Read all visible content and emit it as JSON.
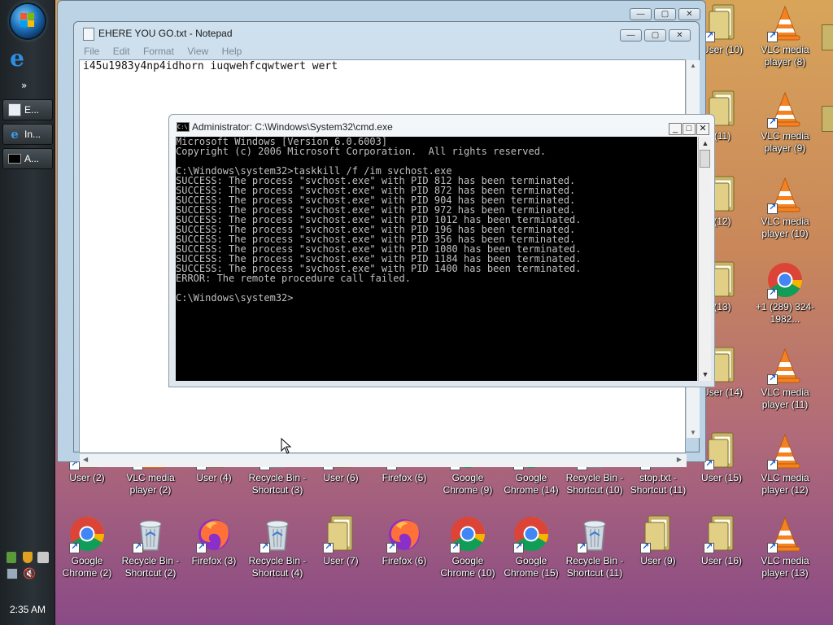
{
  "taskbar": {
    "start_orb": "start-orb-icon",
    "quick_launch_chevron": "»",
    "buttons": [
      {
        "label": "E...",
        "icon": "notepad-icon"
      },
      {
        "label": "In...",
        "icon": "ie-icon"
      },
      {
        "label": "A...",
        "icon": "cmd-icon"
      }
    ],
    "clock": "2:35 AM"
  },
  "notepad": {
    "title": "EHERE YOU GO.txt - Notepad",
    "menu": [
      "File",
      "Edit",
      "Format",
      "View",
      "Help"
    ],
    "content": "i45u1983y4np4idhorn iuqwehfcqwtwert wert"
  },
  "cmd": {
    "title": "Administrator: C:\\Windows\\System32\\cmd.exe",
    "lines": [
      "Microsoft Windows [Version 6.0.6003]",
      "Copyright (c) 2006 Microsoft Corporation.  All rights reserved.",
      "",
      "C:\\Windows\\system32>taskkill /f /im svchost.exe",
      "SUCCESS: The process \"svchost.exe\" with PID 812 has been terminated.",
      "SUCCESS: The process \"svchost.exe\" with PID 872 has been terminated.",
      "SUCCESS: The process \"svchost.exe\" with PID 904 has been terminated.",
      "SUCCESS: The process \"svchost.exe\" with PID 972 has been terminated.",
      "SUCCESS: The process \"svchost.exe\" with PID 1012 has been terminated.",
      "SUCCESS: The process \"svchost.exe\" with PID 196 has been terminated.",
      "SUCCESS: The process \"svchost.exe\" with PID 356 has been terminated.",
      "SUCCESS: The process \"svchost.exe\" with PID 1080 has been terminated.",
      "SUCCESS: The process \"svchost.exe\" with PID 1184 has been terminated.",
      "SUCCESS: The process \"svchost.exe\" with PID 1400 has been terminated.",
      "ERROR: The remote procedure call failed.",
      "",
      "C:\\Windows\\system32>"
    ]
  },
  "desktop": {
    "right_column": [
      {
        "label": "User (10)",
        "icon": "folder-icon"
      },
      {
        "label": "VLC media player (8)",
        "icon": "vlc-icon"
      },
      {
        "label": "(11)",
        "icon": "folder-icon"
      },
      {
        "label": "VLC media player (9)",
        "icon": "vlc-icon"
      },
      {
        "label": "(12)",
        "icon": "folder-icon"
      },
      {
        "label": "VLC media player (10)",
        "icon": "vlc-icon"
      },
      {
        "label": "(13)",
        "icon": "folder-icon"
      },
      {
        "label": "+1 (289) 324-1982...",
        "icon": "chrome-icon"
      },
      {
        "label": "User (14)",
        "icon": "folder-icon"
      },
      {
        "label": "VLC media player (11)",
        "icon": "vlc-icon"
      }
    ],
    "row1": [
      {
        "label": "User (2)",
        "icon": "folder-icon"
      },
      {
        "label": "VLC media player (2)",
        "icon": "vlc-icon"
      },
      {
        "label": "User (4)",
        "icon": "folder-icon"
      },
      {
        "label": "Recycle Bin - Shortcut (3)",
        "icon": "recycle-bin-icon"
      },
      {
        "label": "User (6)",
        "icon": "folder-icon"
      },
      {
        "label": "Firefox (5)",
        "icon": "firefox-icon"
      },
      {
        "label": "Google Chrome (9)",
        "icon": "chrome-icon"
      },
      {
        "label": "Google Chrome (14)",
        "icon": "chrome-icon"
      },
      {
        "label": "Recycle Bin - Shortcut (10)",
        "icon": "recycle-bin-icon"
      },
      {
        "label": "stop.txt - Shortcut (11)",
        "icon": "text-file-icon"
      },
      {
        "label": "User (15)",
        "icon": "folder-icon"
      },
      {
        "label": "VLC media player (12)",
        "icon": "vlc-icon"
      }
    ],
    "row2": [
      {
        "label": "Google Chrome (2)",
        "icon": "chrome-icon"
      },
      {
        "label": "Recycle Bin - Shortcut (2)",
        "icon": "recycle-bin-icon"
      },
      {
        "label": "Firefox (3)",
        "icon": "firefox-icon"
      },
      {
        "label": "Recycle Bin - Shortcut (4)",
        "icon": "recycle-bin-icon"
      },
      {
        "label": "User (7)",
        "icon": "folder-icon"
      },
      {
        "label": "Firefox (6)",
        "icon": "firefox-icon"
      },
      {
        "label": "Google Chrome (10)",
        "icon": "chrome-icon"
      },
      {
        "label": "Google Chrome (15)",
        "icon": "chrome-icon"
      },
      {
        "label": "Recycle Bin - Shortcut (11)",
        "icon": "recycle-bin-icon"
      },
      {
        "label": "User (9)",
        "icon": "folder-icon"
      },
      {
        "label": "User (16)",
        "icon": "folder-icon"
      },
      {
        "label": "VLC media player (13)",
        "icon": "vlc-icon"
      }
    ]
  },
  "colors": {
    "console_bg": "#000000",
    "console_fg": "#c0c0c0",
    "window_chrome": "#bcd3e6"
  }
}
